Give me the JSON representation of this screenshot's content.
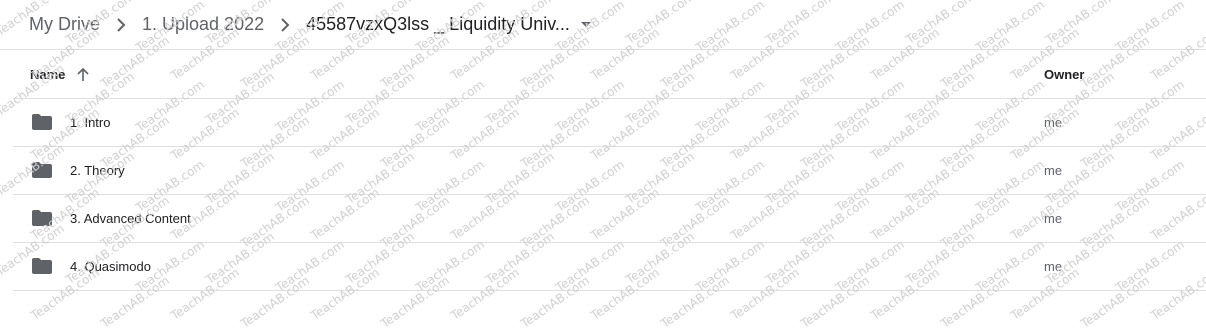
{
  "breadcrumb": {
    "items": [
      "My Drive",
      "1. Upload 2022"
    ],
    "current": "45587vzxQ3lss _ Liquidity Univ..."
  },
  "table": {
    "columns": {
      "name": "Name",
      "owner": "Owner"
    },
    "rows": [
      {
        "name": "1. Intro",
        "owner": "me"
      },
      {
        "name": "2. Theory",
        "owner": "me"
      },
      {
        "name": "3. Advanced Content",
        "owner": "me"
      },
      {
        "name": "4. Quasimodo",
        "owner": "me"
      }
    ]
  },
  "watermark": "TeachAB.com",
  "colors": {
    "folder": "#5f6368",
    "divider": "#e0e0e0",
    "text": "#202124",
    "secondary": "#5f6368"
  }
}
